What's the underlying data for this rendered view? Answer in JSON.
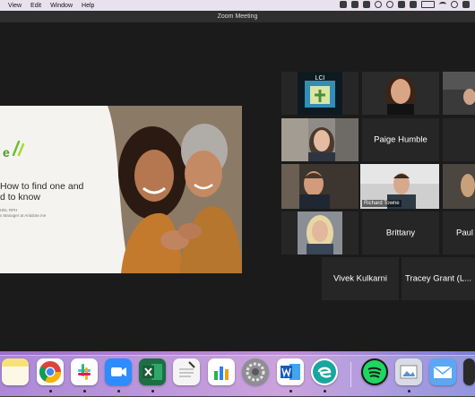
{
  "menubar": {
    "items": [
      "View",
      "Edit",
      "Window",
      "Help"
    ]
  },
  "window": {
    "title": "Zoom Meeting"
  },
  "slide": {
    "logo_text": "e",
    "heading_line1": "How to find one and",
    "heading_line2": "d to know",
    "subline1": "HEL RPH",
    "subline2": "s Manager at Antidote.me"
  },
  "participants": [
    {
      "name": "",
      "kind": "logo",
      "logo_text": "LCI"
    },
    {
      "name": "",
      "kind": "video"
    },
    {
      "name": "",
      "kind": "video"
    },
    {
      "name": "",
      "kind": "video"
    },
    {
      "name": "Paige Humble",
      "kind": "name"
    },
    {
      "name": "",
      "kind": "empty"
    },
    {
      "name": "",
      "kind": "video"
    },
    {
      "name": "Richard Towne",
      "kind": "video-active"
    },
    {
      "name": "",
      "kind": "video"
    },
    {
      "name": "",
      "kind": "video"
    },
    {
      "name": "Brittany",
      "kind": "name"
    },
    {
      "name": "Paul",
      "kind": "name"
    },
    {
      "name": "Vivek Kulkarni",
      "kind": "name"
    },
    {
      "name": "Tracey Grant (L...",
      "kind": "name"
    }
  ],
  "dock": {
    "apps": [
      "notes-app",
      "chrome-app",
      "slack-app",
      "zoom-app",
      "excel-app",
      "textedit-app",
      "numbers-app",
      "system-preferences-app",
      "word-app",
      "edge-app",
      "spotify-app",
      "preview-app",
      "mail-app"
    ]
  },
  "colors": {
    "active_speaker_border": "#c8d946",
    "meeting_background": "#1b1b1b",
    "tile_background": "#262626"
  }
}
